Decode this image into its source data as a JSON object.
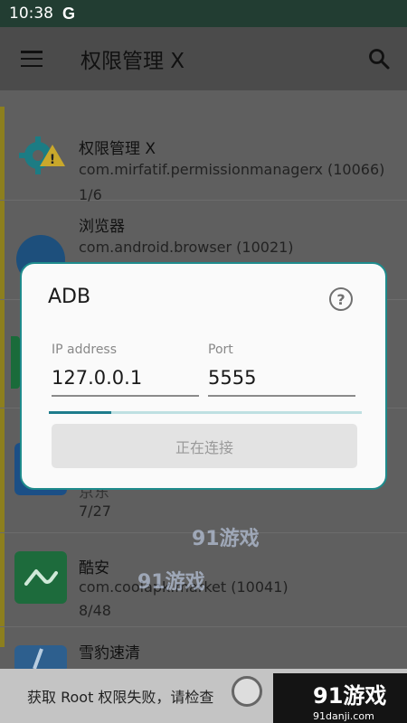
{
  "status_bar": {
    "time": "10:38",
    "notification_glyph": "G"
  },
  "app_bar": {
    "title": "权限管理 X"
  },
  "list": {
    "items": [
      {
        "title": "权限管理 X",
        "package": "com.mirfatif.permissionmanagerx (10066)",
        "count": "1/6",
        "icon": "gear-warning-icon"
      },
      {
        "title": "浏览器",
        "package": "com.android.browser (10021)",
        "count": "",
        "icon": "browser-icon"
      },
      {
        "title": "京东",
        "package": "",
        "count": "7/27",
        "icon": "jd-icon"
      },
      {
        "title": "酷安",
        "package": "com.coolapk.market (10041)",
        "count": "8/48",
        "icon": "coolapk-icon"
      },
      {
        "title": "雪豹速清",
        "package": "",
        "count": "",
        "icon": "xuebao-icon"
      }
    ]
  },
  "dialog": {
    "title": "ADB",
    "ip_label": "IP address",
    "ip_value": "127.0.0.1",
    "port_label": "Port",
    "port_value": "5555",
    "progress": 0.2,
    "connect_label": "正在连接"
  },
  "snackbar": {
    "message": "获取 Root 权限失败，请检查"
  },
  "watermark": {
    "brand": "91游戏",
    "domain": "91danji.com"
  },
  "colors": {
    "accent": "#1e8b8c",
    "dim_overlay": "#5f5f5f",
    "snackbar": "#c4c4c4"
  }
}
